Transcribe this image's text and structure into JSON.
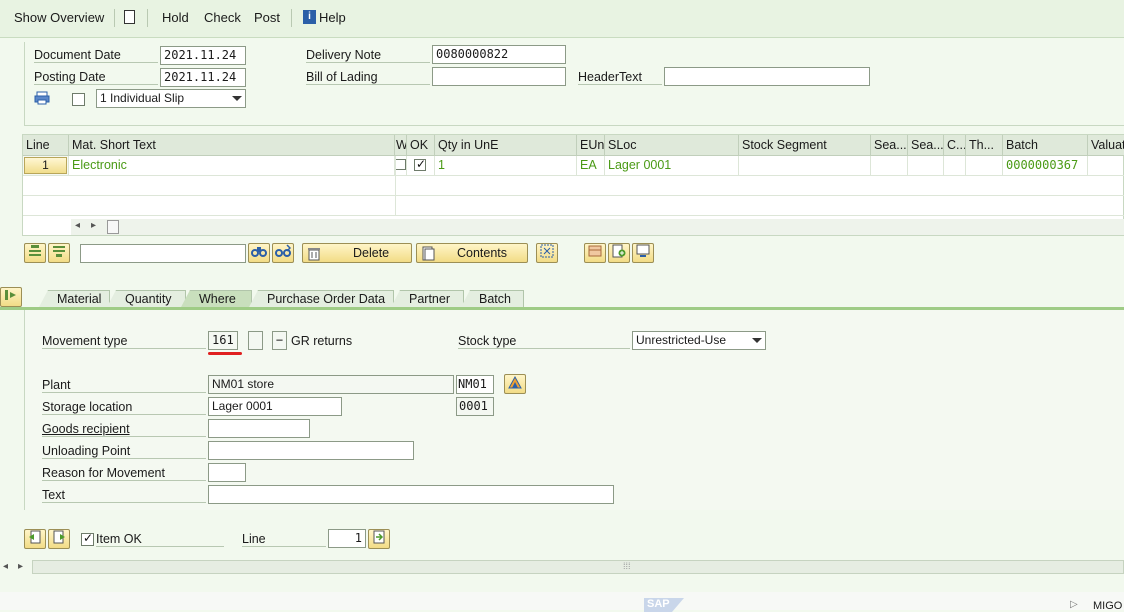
{
  "toolbar": {
    "show_overview": "Show Overview",
    "hold": "Hold",
    "check": "Check",
    "post": "Post",
    "help": "Help"
  },
  "header": {
    "document_date_label": "Document Date",
    "document_date": "2021.11.24",
    "posting_date_label": "Posting Date",
    "posting_date": "2021.11.24",
    "delivery_note_label": "Delivery Note",
    "delivery_note": "0080000822",
    "bill_of_lading_label": "Bill of Lading",
    "bill_of_lading": "",
    "header_text_label": "HeaderText",
    "header_text": "",
    "slip_option": "1 Individual Slip"
  },
  "table": {
    "columns": [
      "Line",
      "Mat. Short Text",
      "W",
      "OK",
      "Qty in UnE",
      "EUn",
      "SLoc",
      "Stock Segment",
      "Sea...",
      "Sea...",
      "C...",
      "Th...",
      "Batch",
      "Valuat"
    ],
    "rows": [
      {
        "line": "1",
        "mat_short_text": "Electronic",
        "w": false,
        "ok": true,
        "qty": "1",
        "eun": "EA",
        "sloc": "Lager 0001",
        "batch": "0000000367"
      }
    ]
  },
  "item_toolbar": {
    "delete": "Delete",
    "contents": "Contents"
  },
  "tabs": [
    "Material",
    "Quantity",
    "Where",
    "Purchase Order Data",
    "Partner",
    "Batch"
  ],
  "active_tab": "Where",
  "where": {
    "movement_type_label": "Movement type",
    "movement_type": "161",
    "movement_sign": "−",
    "movement_desc": "GR returns",
    "stock_type_label": "Stock type",
    "stock_type": "Unrestricted-Use",
    "plant_label": "Plant",
    "plant_name": "NM01 store",
    "plant_code": "NM01",
    "storage_location_label": "Storage location",
    "storage_location_name": "Lager 0001",
    "storage_location_code": "0001",
    "goods_recipient_label": "Goods recipient",
    "goods_recipient": "",
    "unloading_point_label": "Unloading Point",
    "unloading_point": "",
    "reason_label": "Reason for Movement",
    "reason": "",
    "text_label": "Text",
    "text": ""
  },
  "footer": {
    "item_ok_label": "Item OK",
    "item_ok": true,
    "line_label": "Line",
    "line_value": "1"
  },
  "status": {
    "sap_logo": "SAP",
    "transaction": "MIGO"
  },
  "colors": {
    "accent_red": "#e02020",
    "green_text": "#4a9a15",
    "tab_line": "#9fcc86"
  }
}
